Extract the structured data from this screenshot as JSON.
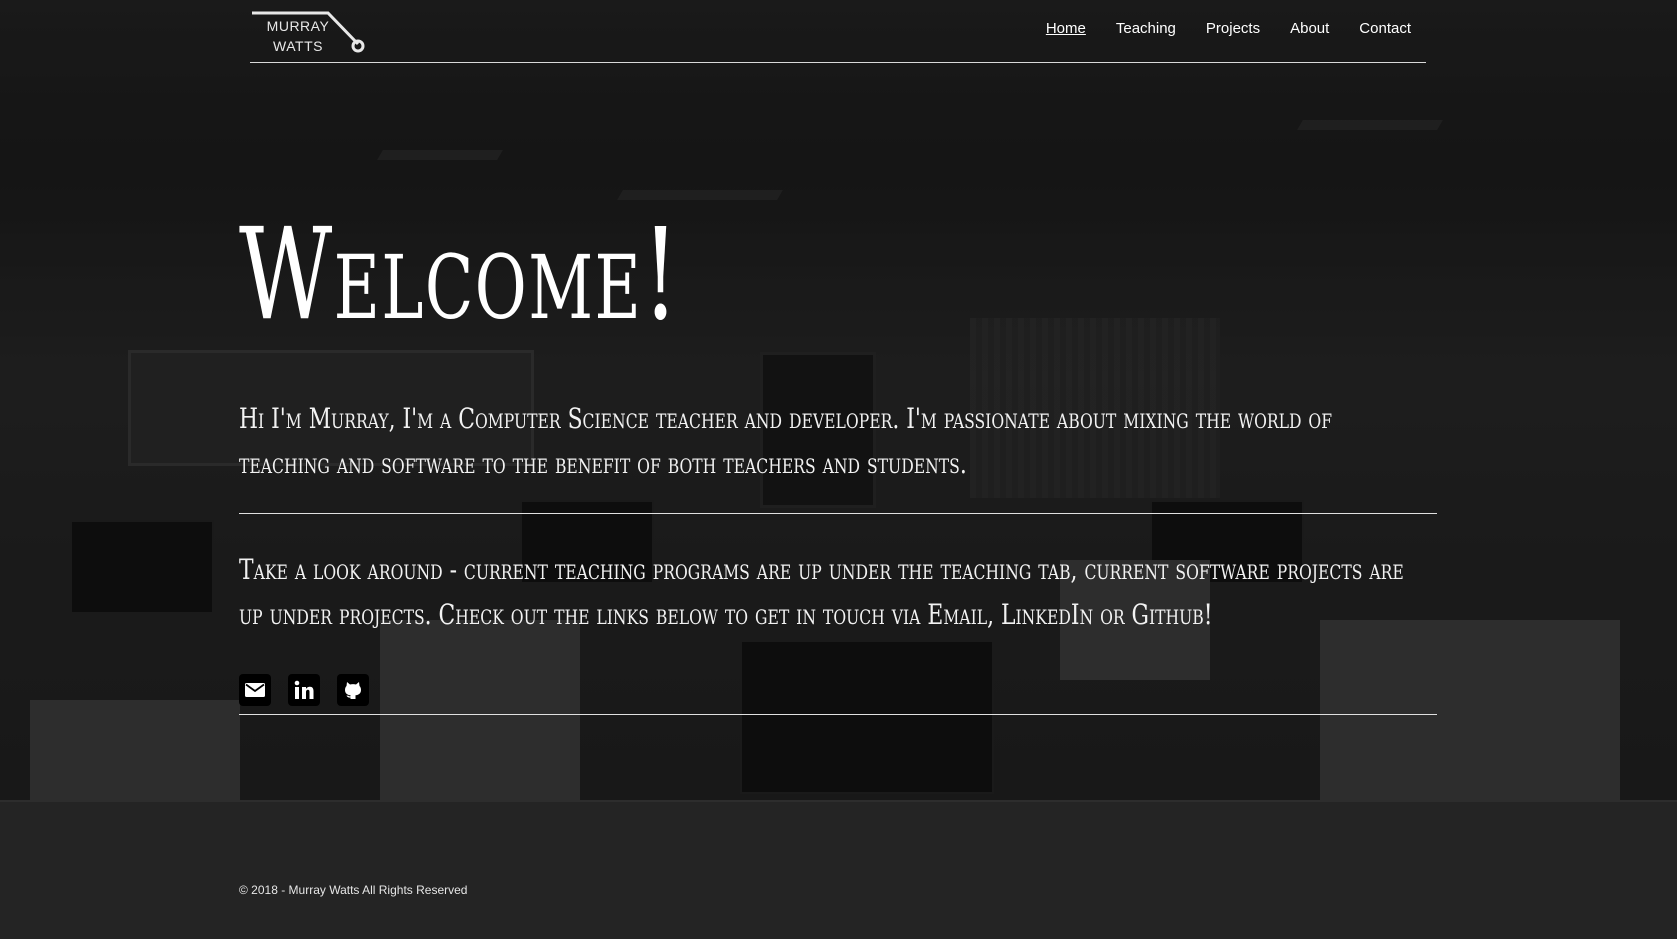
{
  "brand": {
    "line1": "MURRAY",
    "line2": "WATTS"
  },
  "nav": [
    {
      "label": "Home",
      "active": true
    },
    {
      "label": "Teaching",
      "active": false
    },
    {
      "label": "Projects",
      "active": false
    },
    {
      "label": "About",
      "active": false
    },
    {
      "label": "Contact",
      "active": false
    }
  ],
  "hero": {
    "title": "Welcome!",
    "intro": "Hi I'm Murray, I'm a Computer Science teacher and developer. I'm passionate about mixing the world of teaching and software to the benefit of both teachers and students.",
    "invite": "Take a look around - current teaching programs are up under the teaching tab, current software projects are up under projects. Check out the links below to get in touch via Email, LinkedIn or Github!"
  },
  "social": [
    {
      "icon": "mail-icon"
    },
    {
      "icon": "linkedin-icon"
    },
    {
      "icon": "github-icon"
    }
  ],
  "footer": {
    "text": "© 2018 - Murray Watts All Rights Reserved"
  },
  "colors": {
    "text": "#ffffff",
    "overlay": "#000000",
    "icon_bg": "#000000"
  }
}
